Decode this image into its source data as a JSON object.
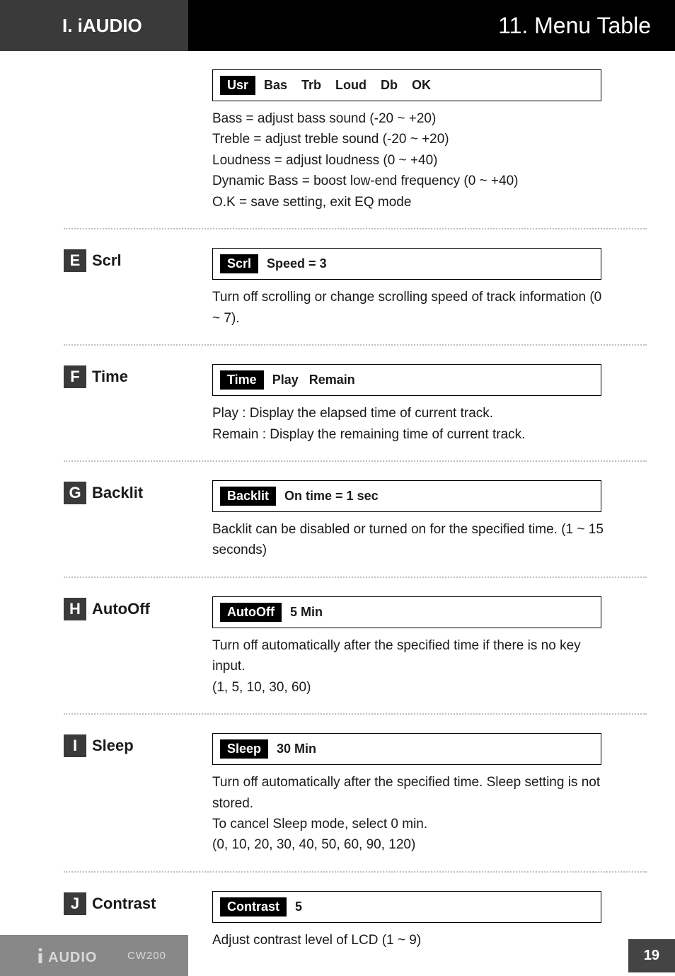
{
  "header": {
    "left": "I. iAUDIO",
    "right": "11. Menu Table"
  },
  "eq": {
    "tag": "Usr",
    "options": "Bas    Trb    Loud    Db    OK",
    "lines": [
      "Bass = adjust bass sound (-20 ~ +20)",
      "Treble = adjust treble sound (-20 ~ +20)",
      "Loudness = adjust loudness (0 ~ +40)",
      "Dynamic Bass = boost low-end frequency (0 ~ +40)",
      "O.K = save setting, exit EQ mode"
    ]
  },
  "items": [
    {
      "letter": "E",
      "name": "Scrl",
      "tag": "Scrl",
      "opt": "Speed = 3",
      "desc": [
        "Turn off scrolling or change scrolling speed of track information (0 ~ 7)."
      ]
    },
    {
      "letter": "F",
      "name": "Time",
      "tag": "Time",
      "opt": "Play   Remain",
      "desc": [
        "Play : Display the elapsed time of current track.",
        "Remain : Display the remaining time of current track."
      ]
    },
    {
      "letter": "G",
      "name": "Backlit",
      "tag": "Backlit",
      "opt": "On time = 1 sec",
      "desc": [
        "Backlit can be disabled or turned on for the specified time. (1 ~ 15 seconds)"
      ]
    },
    {
      "letter": "H",
      "name": "AutoOff",
      "tag": "AutoOff",
      "opt": "5 Min",
      "desc": [
        "Turn off automatically after the specified time if there is no key input.",
        "(1, 5, 10, 30, 60)"
      ]
    },
    {
      "letter": "I",
      "name": "Sleep",
      "tag": "Sleep",
      "opt": "30 Min",
      "desc": [
        "Turn off automatically after the specified time. Sleep setting is not stored.",
        "To cancel Sleep mode, select 0 min.",
        "(0, 10, 20, 30, 40, 50, 60, 90, 120)"
      ]
    },
    {
      "letter": "J",
      "name": "Contrast",
      "tag": "Contrast",
      "opt": "5",
      "desc": [
        "Adjust contrast level of LCD (1 ~ 9)"
      ]
    }
  ],
  "footer": {
    "brand": "AUDIO",
    "model": "CW200",
    "page": "19"
  }
}
